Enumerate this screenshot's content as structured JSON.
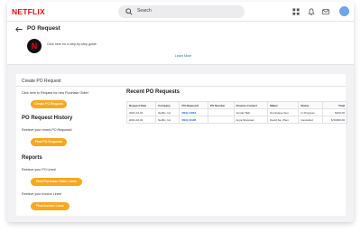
{
  "app": {
    "logo": "NETFLIX",
    "avatar_initials": ""
  },
  "search": {
    "placeholder": "Search"
  },
  "header": {
    "title": "PO Request",
    "guide_text": "Click here for a step-by-step guide.",
    "learn_more": "Learn More",
    "badge": "N"
  },
  "content": {
    "title": "Create PO Request",
    "create_text": "Click here to Request for new Purchase Order!",
    "create_button": "Create PO Request",
    "history_heading": "PO Request History",
    "history_text": "Retrieve your recent PO Requests!",
    "history_button": "Find PO Requests",
    "reports_heading": "Reports",
    "po_lines_text": "Retrieve your PO Lines!",
    "po_lines_button": "Find Purchase Order Lines",
    "invoice_text": "Retrieve your Invoice Lines!",
    "invoice_button": "Find Invoice Lines"
  },
  "recent": {
    "heading": "Recent PO Requests",
    "columns": [
      "Request Date",
      "Company",
      "PO Request#",
      "PO Number",
      "Finance Contact",
      "Maker",
      "Status",
      "Total"
    ],
    "rows": [
      [
        "2021-04-01",
        "Netflix, Inc.",
        "REQ-11853",
        "",
        "Vendor Bell",
        "Dominique Sun",
        "In Progress",
        "$100.00"
      ],
      [
        "2021-06-03",
        "Netflix, Inc.",
        "REQ-10185",
        "",
        "Anya Nkosipan",
        "David Sa, Zhen",
        "Cancelled",
        "$ 50000.00"
      ]
    ]
  },
  "colors": {
    "brand": "#e50914",
    "accent": "#f7a81e",
    "link": "#2a62c9"
  }
}
